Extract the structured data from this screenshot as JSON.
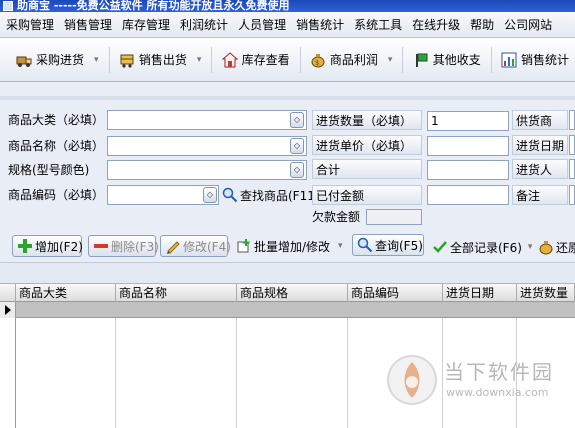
{
  "window": {
    "title": "助商宝 -----免费公益软件 所有功能开放且永久免费使用"
  },
  "menu": [
    "采购管理",
    "销售管理",
    "库存管理",
    "利润统计",
    "人员管理",
    "销售统计",
    "系统工具",
    "在线升级",
    "帮助",
    "公司网站"
  ],
  "toolbar": {
    "purchase": "采购进货",
    "sales": "销售出货",
    "inventory": "库存查看",
    "profit": "商品利润",
    "other": "其他收支",
    "stats": "销售统计"
  },
  "form": {
    "category_label": "商品大类（必填）",
    "name_label": "商品名称（必填）",
    "spec_label": "规格(型号颜色)",
    "code_label": "商品编码（必填）",
    "find_product": "查找商品(F11)",
    "qty_label": "进货数量（必填）",
    "qty_value": "1",
    "price_label": "进货单价（必填）",
    "total_label": "合计",
    "paid_label": "已付金额",
    "owed_label": "欠款金额",
    "supplier_label": "供货商",
    "date_label": "进货日期",
    "buyer_label": "进货人",
    "note_label": "备注"
  },
  "actions": {
    "add": "增加(F2)",
    "delete": "删除(F3)",
    "edit": "修改(F4)",
    "batch": "批量增加/修改",
    "query": "查询(F5)",
    "all_records": "全部记录(F6)",
    "restore": "还原"
  },
  "grid": {
    "columns": [
      "商品大类",
      "商品名称",
      "商品规格",
      "商品编码",
      "进货日期",
      "进货数量"
    ]
  },
  "watermark": {
    "title": "当下软件园",
    "url": "www.downxia.com"
  },
  "colors": {
    "titlebar": "#1c48b8",
    "accent_green": "#2aa52a",
    "accent_red": "#d23a2a",
    "selected_row": "#c0c0c0"
  }
}
